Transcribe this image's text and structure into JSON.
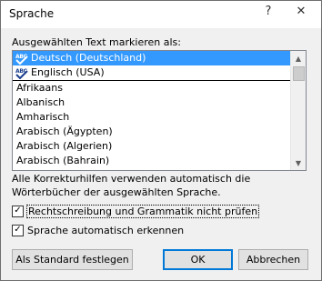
{
  "window": {
    "title": "Sprache",
    "help_glyph": "?",
    "close_glyph": "✕"
  },
  "dialog": {
    "list_label": "Ausgewählten Text markieren als:",
    "languages": [
      {
        "label": "Deutsch (Deutschland)",
        "proofing": true,
        "selected": true
      },
      {
        "label": "Englisch (USA)",
        "proofing": true,
        "selected": false
      },
      {
        "label": "Afrikaans",
        "proofing": false,
        "selected": false
      },
      {
        "label": "Albanisch",
        "proofing": false,
        "selected": false
      },
      {
        "label": "Amharisch",
        "proofing": false,
        "selected": false
      },
      {
        "label": "Arabisch (Ägypten)",
        "proofing": false,
        "selected": false
      },
      {
        "label": "Arabisch (Algerien)",
        "proofing": false,
        "selected": false
      },
      {
        "label": "Arabisch (Bahrain)",
        "proofing": false,
        "selected": false
      }
    ],
    "proof_icon_text": "ABC",
    "info_text": "Alle Korrekturhilfen verwenden automatisch die Wörterbücher der ausgewählten Sprache.",
    "checkbox_no_proof": {
      "label": "Rechtschreibung und Grammatik nicht prüfen",
      "checked": true
    },
    "checkbox_auto_detect": {
      "label": "Sprache automatisch erkennen",
      "checked": true
    },
    "buttons": {
      "set_default": "Als Standard festlegen",
      "ok": "OK",
      "cancel": "Abbrechen"
    }
  },
  "colors": {
    "selection": "#3399ff",
    "ok_border": "#0078d7"
  }
}
